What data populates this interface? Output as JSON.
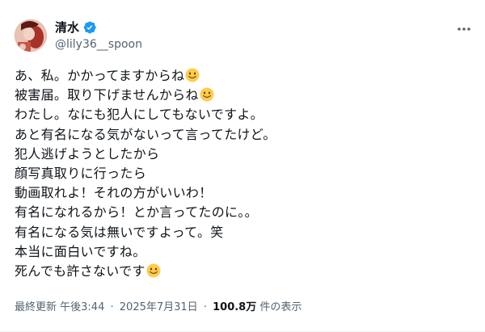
{
  "author": {
    "display_name": "清水",
    "handle": "@lily36__spoon",
    "verified": true
  },
  "tweet": {
    "lines": [
      {
        "text": "あ、私。かかってますからね",
        "emoji": "slightly-smiling-face"
      },
      {
        "text": "被害届。取り下げませんからね",
        "emoji": "slightly-smiling-face"
      },
      {
        "text": "わたし。なにも犯人にしてもないですよ。",
        "emoji": null
      },
      {
        "text": "あと有名になる気がないって言ってたけど。",
        "emoji": null
      },
      {
        "text": "犯人逃げようとしたから",
        "emoji": null
      },
      {
        "text": "顔写真取りに行ったら",
        "emoji": null
      },
      {
        "text": "動画取れよ！それの方がいいわ！",
        "emoji": null
      },
      {
        "text": "有名になれるから！とか言ってたのに。。",
        "emoji": null
      },
      {
        "text": "有名になる気は無いですよって。笑",
        "emoji": null
      },
      {
        "text": "本当に面白いですね。",
        "emoji": null
      },
      {
        "text": "死んでも許さないです",
        "emoji": "slightly-smiling-face"
      }
    ]
  },
  "meta": {
    "edited_label": "最終更新",
    "time": "午後3:44",
    "separator": "·",
    "date": "2025年7月31日",
    "views_count": "100.8万",
    "views_label": "件の表示"
  },
  "colors": {
    "verified_blue": "#1d9bf0",
    "secondary_text": "#536471",
    "primary_text": "#0f1419",
    "emoji_yellow": "#ffcc4d"
  }
}
